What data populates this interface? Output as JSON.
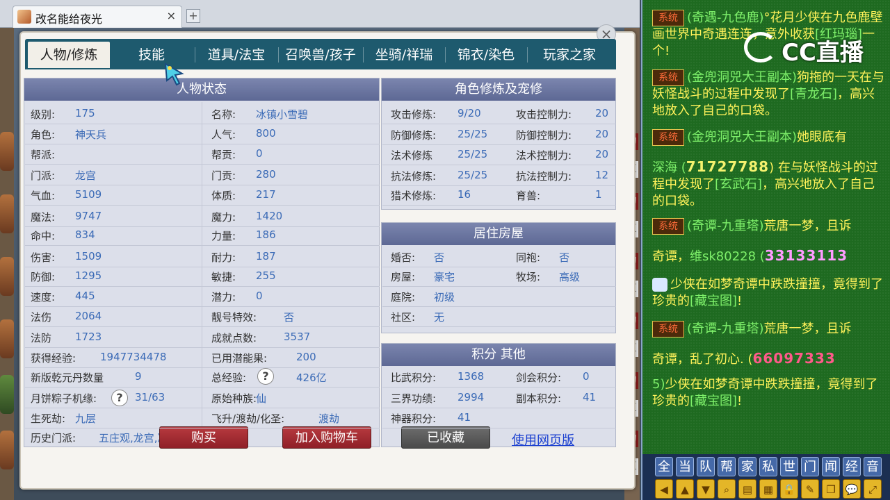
{
  "browser": {
    "tab_title": "改名能给夜光",
    "tab_close": "×",
    "new_tab": "+"
  },
  "dialog": {
    "close": "×",
    "tabs": [
      "人物/修炼",
      "技能",
      "道具/法宝",
      "召唤兽/孩子",
      "坐骑/祥瑞",
      "锦衣/染色",
      "玩家之家"
    ]
  },
  "status": {
    "title": "人物状态",
    "left": [
      {
        "label": "级别:",
        "value": "175"
      },
      {
        "label": "角色:",
        "value": "神天兵"
      },
      {
        "label": "帮派:",
        "value": ""
      },
      {
        "label": "门派:",
        "value": "龙宫"
      },
      {
        "label": "气血:",
        "value": "5109"
      },
      {
        "label": "魔法:",
        "value": "9747"
      },
      {
        "label": "命中:",
        "value": "834"
      },
      {
        "label": "伤害:",
        "value": "1509"
      },
      {
        "label": "防御:",
        "value": "1295"
      },
      {
        "label": "速度:",
        "value": "445"
      },
      {
        "label": "法伤",
        "value": "2064"
      },
      {
        "label": "法防",
        "value": "1723"
      },
      {
        "label": "获得经验:",
        "value": "1947734478"
      },
      {
        "label": "新版乾元丹数量",
        "value": "9"
      },
      {
        "label": "月饼粽子机缘:",
        "value": "31/63"
      },
      {
        "label": "生死劫:",
        "value": "九层"
      }
    ],
    "right": [
      {
        "label": "名称:",
        "value": "冰镇小雪碧"
      },
      {
        "label": "人气:",
        "value": "800"
      },
      {
        "label": "帮贡:",
        "value": "0"
      },
      {
        "label": "门贡:",
        "value": "280"
      },
      {
        "label": "体质:",
        "value": "217"
      },
      {
        "label": "魔力:",
        "value": "1420"
      },
      {
        "label": "力量:",
        "value": "186"
      },
      {
        "label": "耐力:",
        "value": "187"
      },
      {
        "label": "敏捷:",
        "value": "255"
      },
      {
        "label": "潜力:",
        "value": "0"
      },
      {
        "label": "靓号特效:",
        "value": "否"
      },
      {
        "label": "成就点数:",
        "value": "3537"
      },
      {
        "label": "已用潜能果:",
        "value": "200"
      },
      {
        "label": "总经验:",
        "value": "426亿"
      },
      {
        "label": "原始种族:",
        "value": "仙"
      },
      {
        "label": "飞升/渡劫/化圣:",
        "value": "渡劫"
      }
    ],
    "history_label": "历史门派:",
    "history_value": "五庄观,龙宫,凌波城",
    "qmark": "?"
  },
  "cultivation": {
    "title": "角色修炼及宠修",
    "rows": [
      {
        "l1": "攻击修炼:",
        "v1": "9/20",
        "l2": "攻击控制力:",
        "v2": "20"
      },
      {
        "l1": "防御修炼:",
        "v1": "25/25",
        "l2": "防御控制力:",
        "v2": "20"
      },
      {
        "l1": "法术修炼",
        "v1": "25/25",
        "l2": "法术控制力:",
        "v2": "20"
      },
      {
        "l1": "抗法修炼:",
        "v1": "25/25",
        "l2": "抗法控制力:",
        "v2": "12"
      },
      {
        "l1": "猎术修炼:",
        "v1": "16",
        "l2": "育兽:",
        "v2": "1"
      }
    ]
  },
  "housing": {
    "title": "居住房屋",
    "rows": [
      {
        "l1": "婚否:",
        "v1": "否",
        "l2": "同袍:",
        "v2": "否"
      },
      {
        "l1": "房屋:",
        "v1": "豪宅",
        "l2": "牧场:",
        "v2": "高级"
      },
      {
        "l1": "庭院:",
        "v1": "初级",
        "l2": "",
        "v2": ""
      },
      {
        "l1": "社区:",
        "v1": "无",
        "l2": "",
        "v2": ""
      }
    ]
  },
  "points": {
    "title": "积分 其他",
    "rows": [
      {
        "l1": "比武积分:",
        "v1": "1368",
        "l2": "剑会积分:",
        "v2": "0"
      },
      {
        "l1": "三界功绩:",
        "v1": "2994",
        "l2": "副本积分:",
        "v2": "41"
      },
      {
        "l1": "神器积分:",
        "v1": "41",
        "l2": "",
        "v2": ""
      }
    ]
  },
  "actions": {
    "buy": "购买",
    "cart": "加入购物车",
    "favorited": "已收藏",
    "web_version": "使用网页版"
  },
  "chat": {
    "logo": "CC直播",
    "sys_tag": "系统",
    "msg1_a": "(奇遇-九色鹿)",
    "msg1_b": "°花月少侠在九色鹿壁画世界中奇遇连连，意外收获",
    "msg1_c": "[红玛瑙]",
    "msg1_d": "一个!",
    "msg2_a": "(金兜洞兕大王副本)",
    "msg2_b": "狗拖的一天在与妖怪战斗的过程中发现了",
    "msg2_c": "[青龙石]",
    "msg2_d": "，高兴地放入了自己的口袋。",
    "msg3_a": "(金兜洞兕大王副本)",
    "msg3_b": "她眼底有",
    "msg4_a": "深海 (",
    "msg4_b": "71727788",
    "msg4_c": ") 在与妖怪战斗的过程中发现了",
    "msg4_d": "[玄武石]",
    "msg4_e": "，高兴地放入了自己的口袋。",
    "msg5_a": "(奇谭-九重塔)",
    "msg5_b": "荒唐一梦，且诉",
    "msg6_a": "奇谭，",
    "msg6_b": "维sk80228 (",
    "msg6_c": "33133113",
    "msg7_a": "少侠在如梦奇谭中跌跌撞撞，竟得到了珍贵的",
    "msg7_b": "[藏宝图]",
    "msg7_c": "!",
    "msg8_a": "(奇谭-九重塔)",
    "msg8_b": "荒唐一梦，且诉",
    "msg9_a": "奇谭，乱了初心. (",
    "msg9_b": "66097333",
    "msg10_a": "5)",
    "msg10_b": "少侠在如梦奇谭中跌跌撞撞，竟得到了珍贵的",
    "msg10_c": "[藏宝图]",
    "msg10_d": "!",
    "channel_buttons": [
      "全",
      "当",
      "队",
      "帮",
      "家",
      "私",
      "世",
      "门",
      "闻",
      "经",
      "音"
    ],
    "tool_icons": [
      "arrow-left-icon",
      "arrow-up-icon",
      "arrow-down-icon",
      "magnify-icon",
      "note-icon",
      "grid-icon",
      "lock-icon",
      "brush-icon",
      "copy-icon",
      "chat-bubble-icon",
      "expand-icon"
    ],
    "tool_glyphs": [
      "◀",
      "▲",
      "▼",
      "⌕",
      "▤",
      "▦",
      "🔒",
      "✎",
      "❐",
      "💬",
      "⤢"
    ]
  }
}
